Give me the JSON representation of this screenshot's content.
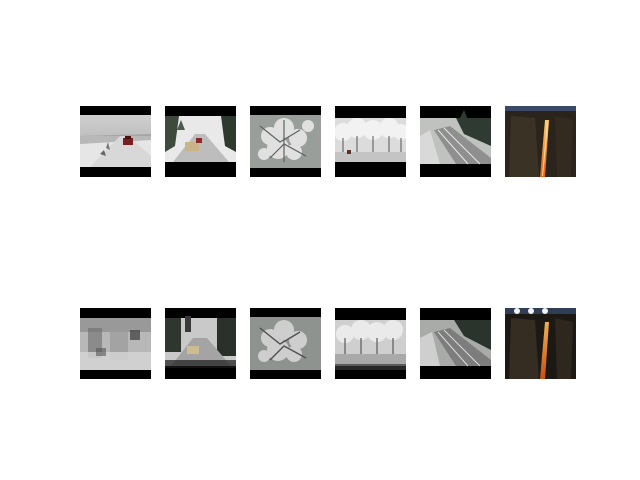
{
  "figure": {
    "background": "#ffffff",
    "rows": [
      {
        "name": "original-frames",
        "thumbnails": [
          {
            "scene": "snowy-highway-red-car",
            "letterbox": true
          },
          {
            "scene": "snowy-road-car-trees",
            "letterbox": true
          },
          {
            "scene": "frosted-pine-branch",
            "letterbox": true
          },
          {
            "scene": "frosted-trees-row",
            "letterbox": true
          },
          {
            "scene": "snowy-railway-forest",
            "letterbox": true
          },
          {
            "scene": "firefall-cliff",
            "letterbox": false
          }
        ]
      },
      {
        "name": "reconstructed-frames",
        "thumbnails": [
          {
            "scene": "snowy-highway-red-car-blurred",
            "letterbox": true
          },
          {
            "scene": "snowy-road-car-trees-blurred",
            "letterbox": true
          },
          {
            "scene": "frosted-pine-branch-blurred",
            "letterbox": true
          },
          {
            "scene": "frosted-trees-row-blurred",
            "letterbox": true
          },
          {
            "scene": "snowy-railway-forest-blurred",
            "letterbox": true
          },
          {
            "scene": "firefall-cliff-artifacts",
            "letterbox": false
          }
        ]
      }
    ]
  }
}
